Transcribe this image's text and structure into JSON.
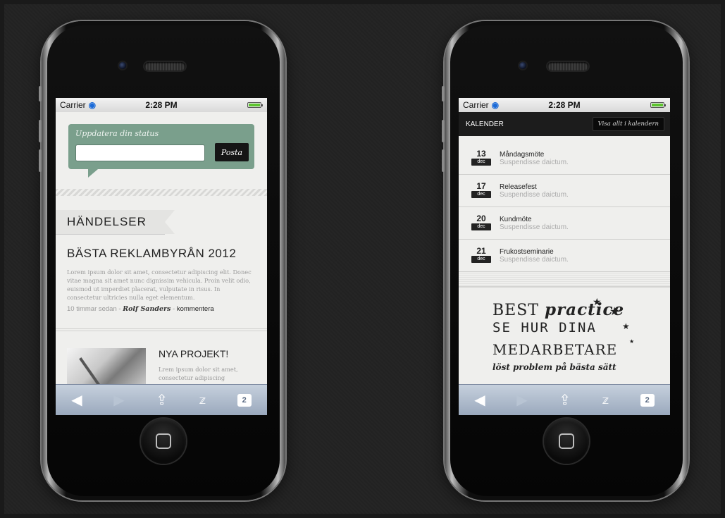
{
  "status_bar": {
    "carrier": "Carrier",
    "time": "2:28 PM"
  },
  "left_screen": {
    "status_form": {
      "label": "Uppdatera din status",
      "input_value": "",
      "post_button": "Posta"
    },
    "events_heading": "HÄNDELSER",
    "article": {
      "title": "BÄSTA REKLAMBYRÅN 2012",
      "body": "Lorem ipsum dolor sit amet, consectetur adipiscing elit. Donec vitae magna sit amet nunc dignissim vehicula. Proin velit odio, euismod ut imperdiet placerat, vulputate in risus. In consectetur ultricies nulla eget elementum.",
      "time_ago": "10 timmar sedan -",
      "author": "Rolf Sanders",
      "separator": " - ",
      "comment_link": "kommentera"
    },
    "project": {
      "title": "NYA PROJEKT!",
      "body": "Lrem ipsum dolor sit amet, consectetur adipiscing"
    }
  },
  "right_screen": {
    "header_title": "KALENDER",
    "view_all_button": "Visa allt i kalendern",
    "events": [
      {
        "day": "13",
        "month": "dec",
        "title": "Måndagsmöte",
        "subtitle": "Suspendisse daictum."
      },
      {
        "day": "17",
        "month": "dec",
        "title": "Releasefest",
        "subtitle": "Suspendisse daictum."
      },
      {
        "day": "20",
        "month": "dec",
        "title": "Kundmöte",
        "subtitle": "Suspendisse daictum."
      },
      {
        "day": "21",
        "month": "dec",
        "title": "Frukostseminarie",
        "subtitle": "Suspendisse daictum."
      }
    ],
    "promo": {
      "line1_a": "BEST",
      "line1_b": "practice",
      "line2": "SE HUR DINA",
      "line3": "MEDARBETARE",
      "line4": "löst problem på bästa sätt"
    }
  },
  "toolbar": {
    "back_icon": "◀",
    "forward_icon": "▶",
    "share_icon": "⇪",
    "bookmarks_icon": "📖",
    "tabs_count": "2"
  },
  "colors": {
    "status_box_green": "#7a9f8c",
    "toolbar_blue": "#9aa9bd",
    "battery_green": "#5dc52f"
  }
}
